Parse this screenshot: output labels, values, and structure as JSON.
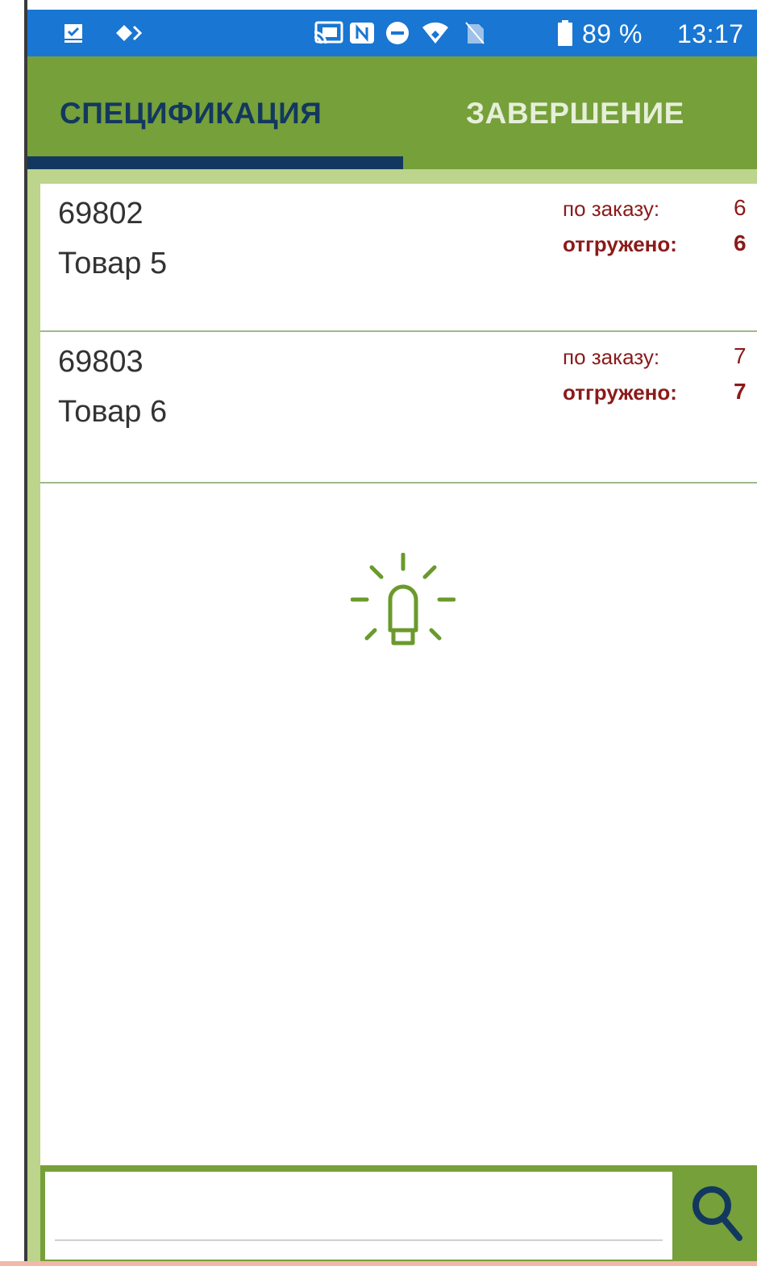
{
  "status_bar": {
    "battery": "89 %",
    "time": "13:17",
    "icons": [
      "checkbox-notification-icon",
      "diamond-notification-icon",
      "cast-icon",
      "nfc-icon",
      "do-not-disturb-icon",
      "wifi-icon",
      "no-sim-icon",
      "battery-icon"
    ]
  },
  "tabs": [
    {
      "label": "СПЕЦИФИКАЦИЯ",
      "active": true
    },
    {
      "label": "ЗАВЕРШЕНИЕ",
      "active": false
    }
  ],
  "items": [
    {
      "code": "69802",
      "name": "Товар 5",
      "order_label": "по заказу:",
      "order_qty": "6",
      "shipped_label": "отгружено:",
      "shipped_qty": "6"
    },
    {
      "code": "69803",
      "name": "Товар 6",
      "order_label": "по заказу:",
      "order_qty": "7",
      "shipped_label": "отгружено:",
      "shipped_qty": "7"
    }
  ],
  "hint": {
    "icon": "light-bulb-icon"
  },
  "search": {
    "value": "",
    "placeholder": "",
    "button_icon": "search-icon"
  },
  "colors": {
    "status_bar": "#1976d2",
    "tab_bar": "#76a03a",
    "tab_active_text": "#13385f",
    "tab_indicator": "#13385f",
    "content_bg": "#bcd48b",
    "qty_text": "#8b1a1a",
    "icon_green": "#6a9a2c"
  }
}
